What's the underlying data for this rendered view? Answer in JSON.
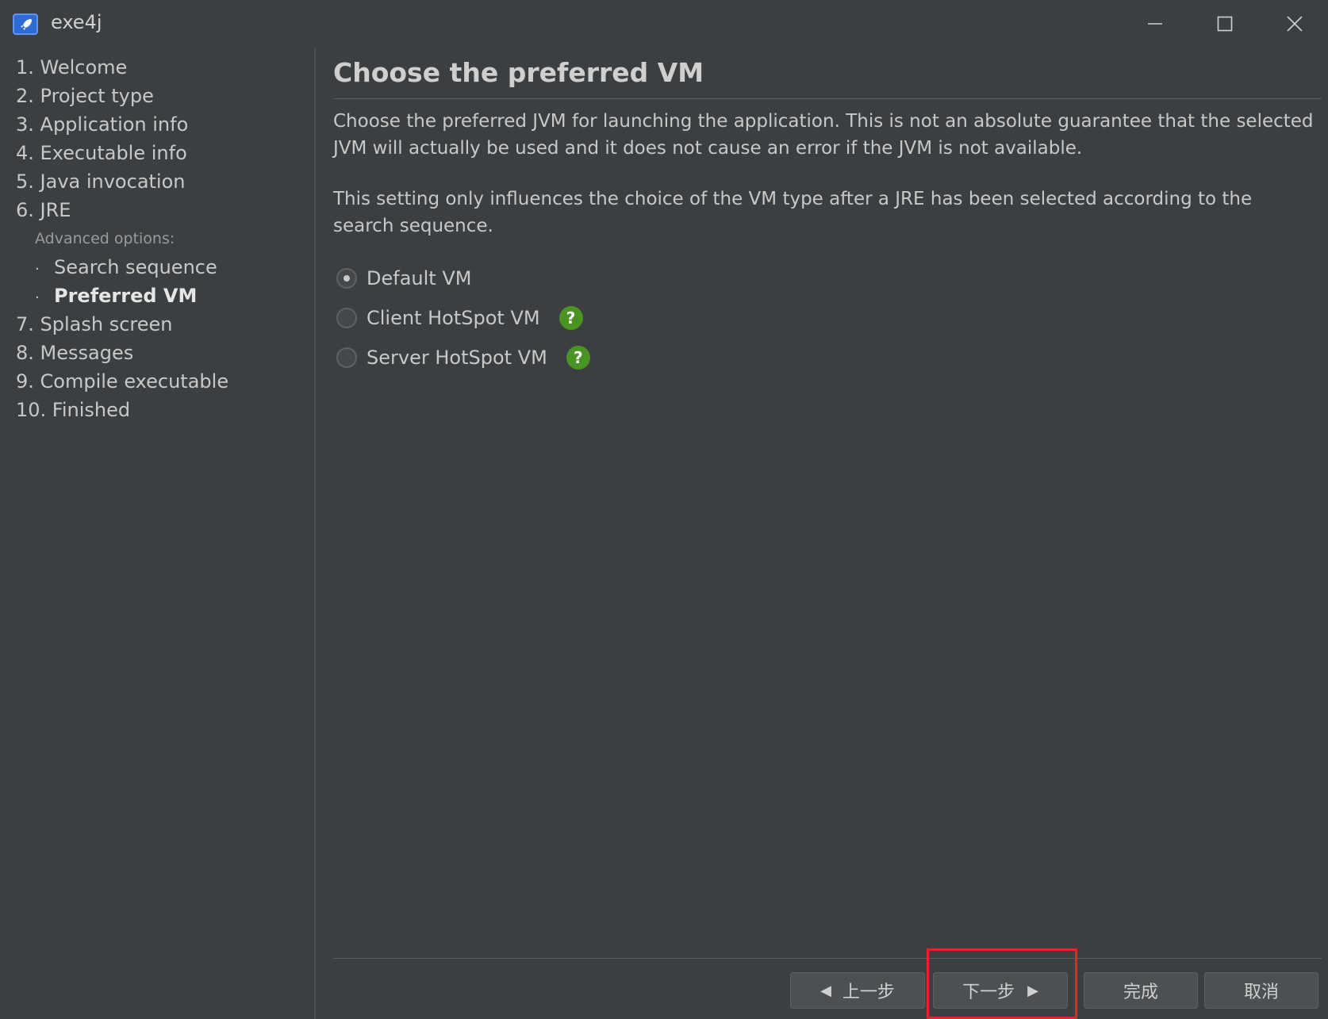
{
  "window": {
    "title": "exe4j",
    "icon": "rocket-icon"
  },
  "sidebar": {
    "items": [
      {
        "label": "1. Welcome"
      },
      {
        "label": "2. Project type"
      },
      {
        "label": "3. Application info"
      },
      {
        "label": "4. Executable info"
      },
      {
        "label": "5. Java invocation"
      },
      {
        "label": "6. JRE"
      },
      {
        "label": "7. Splash screen"
      },
      {
        "label": "8. Messages"
      },
      {
        "label": "9. Compile executable"
      },
      {
        "label": "10. Finished"
      }
    ],
    "advanced_heading": "Advanced options:",
    "sub_items": [
      {
        "label": "Search sequence",
        "active": false
      },
      {
        "label": "Preferred VM",
        "active": true
      }
    ],
    "bullet": "·"
  },
  "main": {
    "title": "Choose the preferred VM",
    "paragraph1": "Choose the preferred JVM for launching the application. This is not an absolute guarantee that the selected JVM will actually be used and it does not cause an error if the JVM is not available.",
    "paragraph2": "This setting only influences the choice of the VM type after a JRE has been selected according to the search sequence.",
    "options": [
      {
        "label": "Default VM",
        "checked": true,
        "help": false
      },
      {
        "label": "Client HotSpot VM",
        "checked": false,
        "help": true
      },
      {
        "label": "Server HotSpot VM",
        "checked": false,
        "help": true
      }
    ],
    "help_glyph": "?"
  },
  "footer": {
    "back_label": "上一步",
    "next_label": "下一步",
    "finish_label": "完成",
    "cancel_label": "取消",
    "back_arrow": "◀",
    "next_arrow": "▶"
  },
  "colors": {
    "background": "#3c3f41",
    "help_icon": "#4a9423",
    "highlight": "#e0262b"
  }
}
